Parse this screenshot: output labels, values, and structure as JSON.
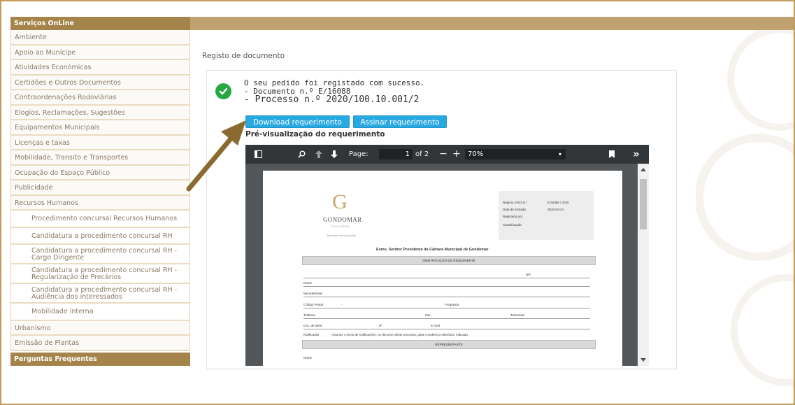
{
  "sidebar": {
    "header": "Serviços OnLine",
    "items": [
      {
        "label": "Ambiente"
      },
      {
        "label": "Apoio ao Munícipe"
      },
      {
        "label": "Atividades Económicas"
      },
      {
        "label": "Certidões e Outros Documentos"
      },
      {
        "label": "Contraordenações Rodoviárias"
      },
      {
        "label": "Elogios, Reclamações, Sugestões"
      },
      {
        "label": "Equipamentos Municipais"
      },
      {
        "label": "Licenças e taxas"
      },
      {
        "label": "Mobilidade, Transito e Transportes"
      },
      {
        "label": "Ocupação do Espaço Público"
      },
      {
        "label": "Publicidade"
      },
      {
        "label": "Recursos Humanos"
      }
    ],
    "subitems": [
      {
        "label": "Procedimento concursal Recursos Humanos"
      },
      {
        "label": "Candidatura a procedimento concursal RH"
      },
      {
        "line1": "Candidatura a procedimento concursal RH -",
        "line2": "Cargo Dirigente"
      },
      {
        "line1": "Candidatura a procedimento concursal RH -",
        "line2": "Regularização de Precários"
      },
      {
        "line1": "Candidatura a procedimento concursal RH -",
        "line2": "Audiência dos interessados"
      },
      {
        "label": "Mobilidade interna"
      }
    ],
    "items_after": [
      {
        "label": "Urbanismo"
      },
      {
        "label": "Emissão de Plantas"
      }
    ],
    "footer": "Perguntas Frequentes"
  },
  "main": {
    "page_title": "Registo de documento",
    "success_message": "O seu pedido foi registado com sucesso.",
    "document_line": "- Documento n.º E/16088",
    "process_line": "- Processo n.º 2020/100.10.001/2",
    "download_button": "Download requerimento",
    "sign_button": "Assinar requerimento",
    "preview_label": "Pré-visualização do requerimento"
  },
  "pdf_viewer": {
    "page_label": "Page:",
    "current_page": "1",
    "page_total": "of 2",
    "zoom": "70%",
    "zoom_out_label": "−",
    "zoom_in_label": "+",
    "more_label": "»"
  },
  "document": {
    "logo_name": "GONDOMAR",
    "logo_tagline": "Ouro e Prata",
    "logo_small": "Município de Gondomar",
    "reg_labels": [
      "Registo VISO N.º",
      "Data de Entrada",
      "Registado por:",
      "Classificação:"
    ],
    "reg_values": [
      "E/16088 / 2020",
      "2020-03-24"
    ],
    "addressee": "Exmo. Senhor Presidente da Câmara Municipal de Gondomar",
    "section_applicant": "IDENTIFICAÇÃO DO REQUERENTE",
    "section_representative": "REPRESENTANTE",
    "field_nif": "NIF",
    "field_nome": "Nome",
    "field_morada": "Morada/Sede",
    "field_codigo_postal": "Código Postal",
    "field_codigo_sep": "-",
    "field_freguesia": "Freguesia",
    "field_telefone": "Telefone",
    "field_fax": "Fax",
    "field_telemovel": "Telemóvel",
    "field_doc": "Doc. de ident.",
    "field_doc_num": "Nº",
    "field_email": "E-mail",
    "field_notificacao": "Notificação",
    "notification_text": "Autorizo o envio de notificações, no decorrer deste processo, para o endereço eletrónico indicado.",
    "field_nome_rep": "Nome"
  },
  "colors": {
    "accent_gold": "#a5844c",
    "topbar_gold": "#bfa26f",
    "button_blue": "#28a9e1",
    "success_green": "#28a745",
    "arrow_brown": "#8a6a2e"
  }
}
